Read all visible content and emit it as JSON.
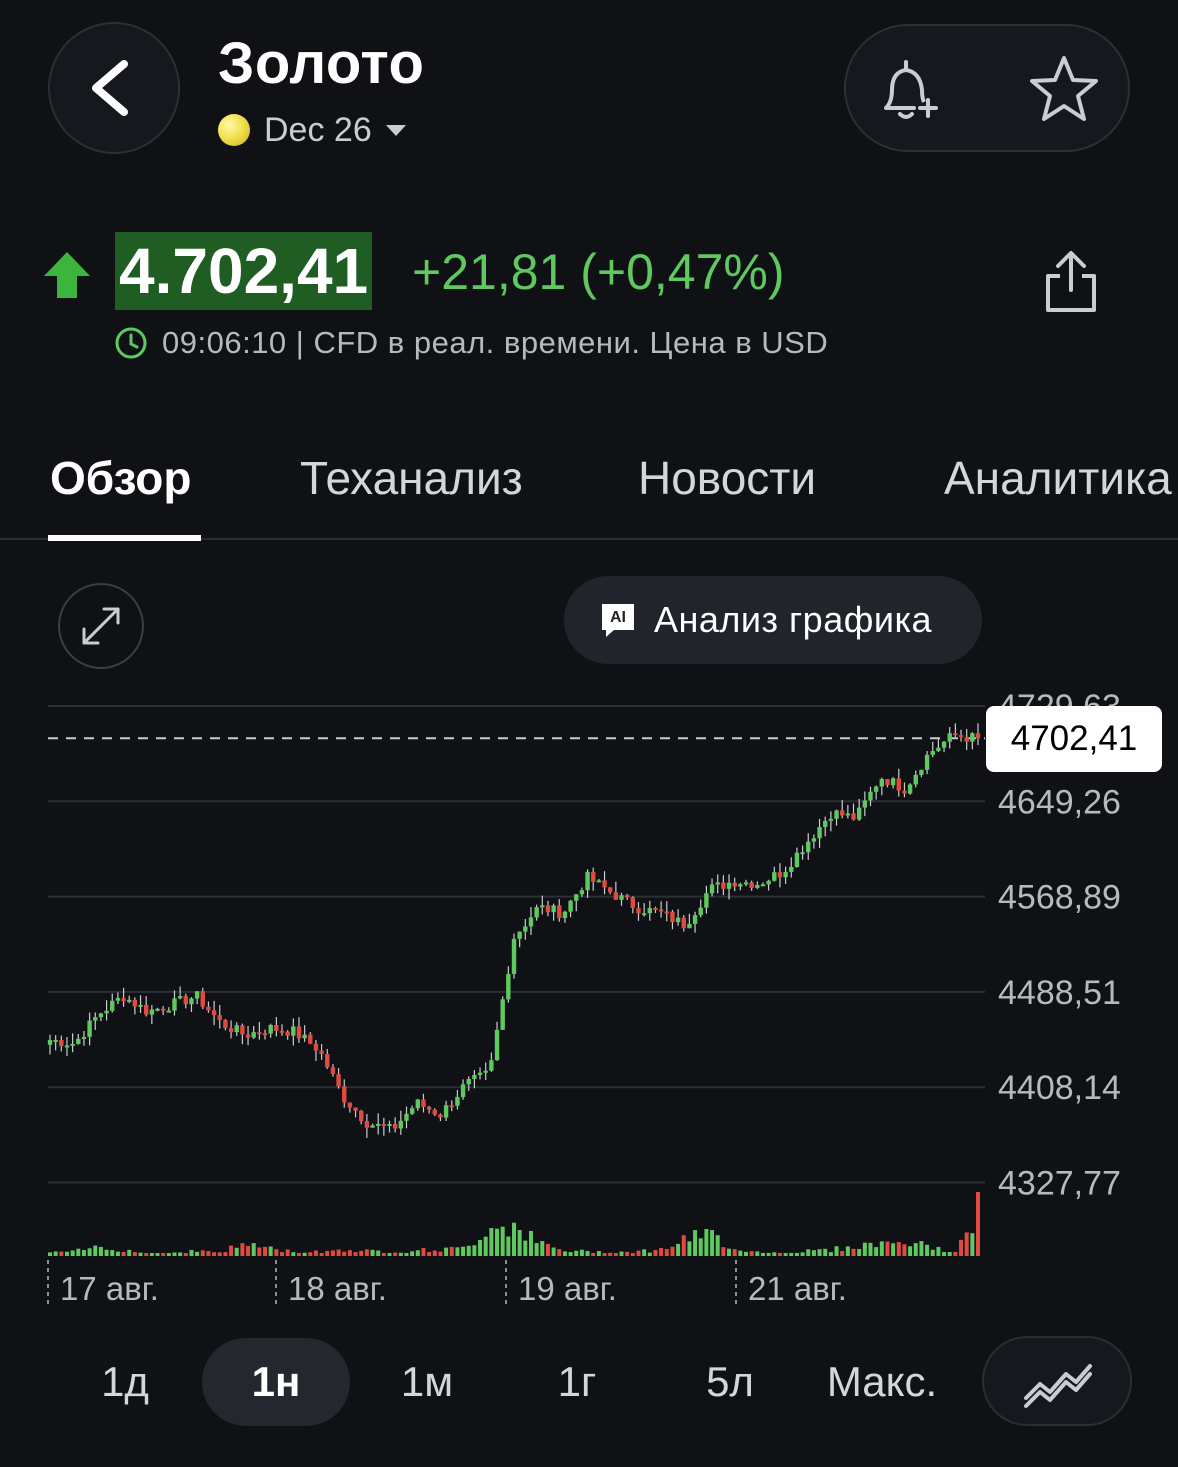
{
  "header": {
    "title": "Золото",
    "contract": "Dec 26",
    "icons": {
      "back": "chevron-left-icon",
      "bell": "bell-plus-icon",
      "star": "star-icon"
    }
  },
  "quote": {
    "price": "4.702,41",
    "change": "+21,81 (+0,47%)",
    "subline": "09:06:10 | CFD в реал. времени. Цена в USD",
    "direction": "up",
    "colors": {
      "up": "#5ec95e",
      "down": "#e04a3f",
      "price_bg": "#1f5d22"
    }
  },
  "tabs": [
    {
      "label": "Обзор",
      "active": true
    },
    {
      "label": "Теханализ"
    },
    {
      "label": "Новости"
    },
    {
      "label": "Аналитика"
    }
  ],
  "chart_toolbar": {
    "ai_label": "Анализ графика",
    "ai_icon_text": "AI"
  },
  "timeframes": [
    {
      "label": "1д"
    },
    {
      "label": "1н",
      "active": true
    },
    {
      "label": "1м"
    },
    {
      "label": "1г"
    },
    {
      "label": "5л"
    },
    {
      "label": "Макс."
    }
  ],
  "chart_data": {
    "type": "candlestick",
    "current_price_label": "4702,41",
    "current_price": 4702.41,
    "y_ticks": [
      4729.63,
      4649.26,
      4568.89,
      4488.51,
      4408.14,
      4327.77
    ],
    "y_tick_labels": [
      "4729,63",
      "4649,26",
      "4568,89",
      "4488,51",
      "4408,14",
      "4327,77"
    ],
    "x_labels": [
      "17 авг.",
      "18 авг.",
      "19 авг.",
      "21 авг."
    ],
    "close_path": [
      4448,
      4445,
      4470,
      4485,
      4472,
      4478,
      4485,
      4462,
      4452,
      4458,
      4455,
      4440,
      4400,
      4378,
      4372,
      4395,
      4385,
      4410,
      4420,
      4535,
      4560,
      4555,
      4585,
      4572,
      4560,
      4555,
      4545,
      4575,
      4582,
      4580,
      4590,
      4615,
      4640,
      4635,
      4670,
      4660,
      4690,
      4705,
      4702
    ],
    "volume_profile": [
      0.05,
      0.07,
      0.15,
      0.1,
      0.04,
      0.05,
      0.08,
      0.06,
      0.2,
      0.12,
      0.06,
      0.07,
      0.1,
      0.08,
      0.06,
      0.09,
      0.1,
      0.12,
      0.45,
      0.5,
      0.2,
      0.08,
      0.07,
      0.06,
      0.07,
      0.1,
      0.25,
      0.35,
      0.12,
      0.06,
      0.05,
      0.08,
      0.1,
      0.15,
      0.2,
      0.22,
      0.15,
      0.05,
      0.55
    ]
  }
}
